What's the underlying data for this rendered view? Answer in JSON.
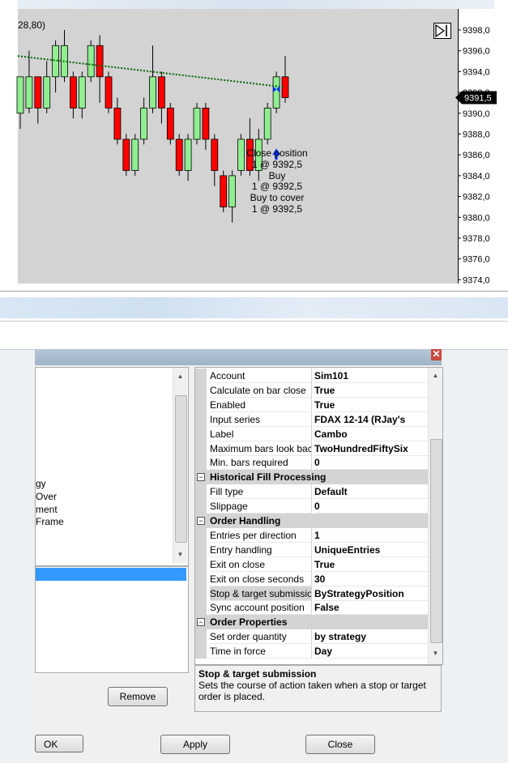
{
  "chart": {
    "corner_label": "28,80)",
    "price_marker": "9391,5",
    "y_axis_labels": [
      "9398,0",
      "9396,0",
      "9394,0",
      "9392,0",
      "9390,0",
      "9388,0",
      "9386,0",
      "9384,0",
      "9382,0",
      "9380,0",
      "9378,0",
      "9376,0",
      "9374,0"
    ],
    "annotation_lines": [
      "Close position",
      "1 @ 9392,5",
      "Buy",
      "1 @ 9392,5",
      "Buy to cover",
      "1 @ 9392,5"
    ],
    "colors": {
      "up": "#90ee90",
      "down": "#ff0000",
      "panel": "#d3d3d3",
      "trendline": "#006400",
      "arrow": "#0033ff"
    }
  },
  "chart_data": {
    "type": "candlestick",
    "ylim": [
      9374,
      9399
    ],
    "candles": [
      {
        "o": 9390.0,
        "c": 9393.5,
        "h": 9393.5,
        "l": 9388.5
      },
      {
        "o": 9390.5,
        "c": 9393.5,
        "h": 9396.0,
        "l": 9390.0
      },
      {
        "o": 9393.5,
        "c": 9390.5,
        "h": 9393.5,
        "l": 9389.0
      },
      {
        "o": 9390.5,
        "c": 9393.5,
        "h": 9395.0,
        "l": 9390.0
      },
      {
        "o": 9393.5,
        "c": 9396.5,
        "h": 9397.0,
        "l": 9392.0
      },
      {
        "o": 9393.5,
        "c": 9396.5,
        "h": 9398.0,
        "l": 9393.0
      },
      {
        "o": 9393.5,
        "c": 9390.5,
        "h": 9394.0,
        "l": 9389.5
      },
      {
        "o": 9390.5,
        "c": 9393.5,
        "h": 9394.0,
        "l": 9389.5
      },
      {
        "o": 9393.5,
        "c": 9396.5,
        "h": 9397.0,
        "l": 9393.0
      },
      {
        "o": 9396.5,
        "c": 9393.5,
        "h": 9397.5,
        "l": 9391.0
      },
      {
        "o": 9393.5,
        "c": 9390.5,
        "h": 9394.0,
        "l": 9390.0
      },
      {
        "o": 9390.5,
        "c": 9387.5,
        "h": 9391.5,
        "l": 9387.0
      },
      {
        "o": 9387.5,
        "c": 9384.5,
        "h": 9388.0,
        "l": 9384.0
      },
      {
        "o": 9384.5,
        "c": 9387.5,
        "h": 9388.0,
        "l": 9384.0
      },
      {
        "o": 9387.5,
        "c": 9390.5,
        "h": 9391.5,
        "l": 9387.0
      },
      {
        "o": 9390.5,
        "c": 9393.5,
        "h": 9396.5,
        "l": 9390.0
      },
      {
        "o": 9393.5,
        "c": 9390.5,
        "h": 9394.0,
        "l": 9389.0
      },
      {
        "o": 9390.5,
        "c": 9387.5,
        "h": 9391.0,
        "l": 9387.0
      },
      {
        "o": 9387.5,
        "c": 9384.5,
        "h": 9388.0,
        "l": 9384.0
      },
      {
        "o": 9384.5,
        "c": 9387.5,
        "h": 9388.0,
        "l": 9383.5
      },
      {
        "o": 9387.5,
        "c": 9390.5,
        "h": 9391.0,
        "l": 9387.0
      },
      {
        "o": 9390.5,
        "c": 9387.5,
        "h": 9391.0,
        "l": 9386.5
      },
      {
        "o": 9387.5,
        "c": 9384.5,
        "h": 9388.0,
        "l": 9383.0
      },
      {
        "o": 9384.0,
        "c": 9381.0,
        "h": 9384.5,
        "l": 9380.5
      },
      {
        "o": 9381.0,
        "c": 9384.0,
        "h": 9384.5,
        "l": 9379.5
      },
      {
        "o": 9384.5,
        "c": 9387.5,
        "h": 9388.0,
        "l": 9384.0
      },
      {
        "o": 9387.5,
        "c": 9384.5,
        "h": 9389.5,
        "l": 9384.0
      },
      {
        "o": 9384.5,
        "c": 9387.5,
        "h": 9388.5,
        "l": 9383.5
      },
      {
        "o": 9387.5,
        "c": 9390.5,
        "h": 9391.0,
        "l": 9387.0
      },
      {
        "o": 9390.5,
        "c": 9393.5,
        "h": 9394.0,
        "l": 9390.0
      },
      {
        "o": 9393.5,
        "c": 9391.5,
        "h": 9395.5,
        "l": 9391.0
      }
    ],
    "trendline": {
      "from": 9395.5,
      "to": 9392.5
    }
  },
  "dialog": {
    "close_glyph": "✕",
    "left_items": [
      "gy",
      "Over",
      "ment",
      "Frame"
    ],
    "remove_label": "Remove",
    "ok_label": "OK",
    "apply_label": "Apply",
    "close_label": "Close",
    "rows": [
      {
        "kind": "prop",
        "name": "Account",
        "value": "Sim101"
      },
      {
        "kind": "prop",
        "name": "Calculate on bar close",
        "value": "True"
      },
      {
        "kind": "prop",
        "name": "Enabled",
        "value": "True"
      },
      {
        "kind": "prop",
        "name": "Input series",
        "value": "FDAX 12-14 (RJay's"
      },
      {
        "kind": "prop",
        "name": "Label",
        "value": "Cambo"
      },
      {
        "kind": "prop",
        "name": "Maximum bars look back",
        "value": "TwoHundredFiftySix"
      },
      {
        "kind": "prop",
        "name": "Min. bars required",
        "value": "0"
      },
      {
        "kind": "cat",
        "name": "Historical Fill Processing",
        "toggle": "⊟"
      },
      {
        "kind": "prop",
        "name": "Fill type",
        "value": "Default"
      },
      {
        "kind": "prop",
        "name": "Slippage",
        "value": "0"
      },
      {
        "kind": "cat",
        "name": "Order Handling",
        "toggle": "⊟"
      },
      {
        "kind": "prop",
        "name": "Entries per direction",
        "value": "1"
      },
      {
        "kind": "prop",
        "name": "Entry handling",
        "value": "UniqueEntries"
      },
      {
        "kind": "prop",
        "name": "Exit on close",
        "value": "True"
      },
      {
        "kind": "prop",
        "name": "Exit on close seconds",
        "value": "30"
      },
      {
        "kind": "prop",
        "name": "Stop & target submission",
        "value": "ByStrategyPosition",
        "selected": true
      },
      {
        "kind": "prop",
        "name": "Sync account position",
        "value": "False"
      },
      {
        "kind": "cat",
        "name": "Order Properties",
        "toggle": "⊟"
      },
      {
        "kind": "prop",
        "name": "Set order quantity",
        "value": "by strategy"
      },
      {
        "kind": "prop",
        "name": "Time in force",
        "value": "Day"
      }
    ],
    "description": {
      "title": "Stop & target submission",
      "text": "Sets the course of action taken when a stop or target order is placed."
    }
  }
}
